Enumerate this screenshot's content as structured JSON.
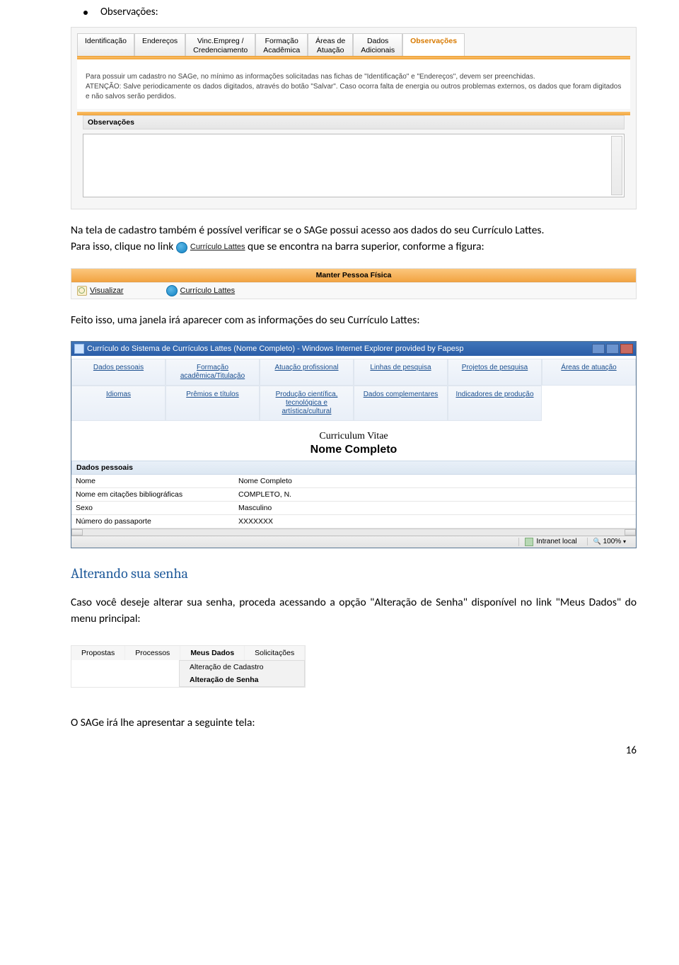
{
  "bullet": {
    "label": "Observações:"
  },
  "tabs": {
    "items": [
      "Identificação",
      "Endereços",
      "Vinc.Empreg /\nCredenciamento",
      "Formação\nAcadêmica",
      "Áreas de\nAtuação",
      "Dados\nAdicionais",
      "Observações"
    ],
    "selected_index": 6
  },
  "info_text": "Para possuir um cadastro no SAGe, no mínimo as informações solicitadas nas fichas de \"Identificação\" e \"Endereços\", devem ser preenchidas.\nATENÇÃO: Salve periodicamente os dados digitados, através do botão \"Salvar\". Caso ocorra falta de energia ou outros problemas externos, os dados que foram digitados e não salvos serão perdidos.",
  "obs_section_label": "Observações",
  "para1_a": "Na tela de cadastro também é possível verificar se o SAGe possui acesso aos dados do seu Currículo Lattes.",
  "para1_b_pre": "Para isso, clique no link ",
  "para1_b_link": "Currículo Lattes",
  "para1_b_post": " que se encontra na barra superior, conforme a figura:",
  "manter": {
    "title": "Manter Pessoa Física",
    "visualizar": "Visualizar",
    "lattes": "Currículo Lattes"
  },
  "para2": "Feito isso, uma janela irá aparecer com as informações do seu Currículo Lattes:",
  "ie": {
    "title": "Currículo do Sistema de Currículos Lattes (Nome Completo) - Windows Internet Explorer provided by Fapesp",
    "nav_row1": [
      "Dados pessoais",
      "Formação\nacadêmica/Titulação",
      "Atuação profissional",
      "Linhas de pesquisa",
      "Projetos de pesquisa",
      "Áreas de atuação"
    ],
    "nav_row2": [
      "Idiomas",
      "Prêmios e títulos",
      "Produção científica,\ntecnológica e artística/cultural",
      "Dados complementares",
      "Indicadores de produção",
      ""
    ],
    "cv_label": "Curriculum Vitae",
    "name": "Nome Completo",
    "section": "Dados pessoais",
    "rows": [
      {
        "k": "Nome",
        "v": "Nome Completo"
      },
      {
        "k": "Nome em citações bibliográficas",
        "v": "COMPLETO, N."
      },
      {
        "k": "Sexo",
        "v": "Masculino"
      },
      {
        "k": "Número do passaporte",
        "v": "XXXXXXX"
      }
    ],
    "zone": "Intranet local",
    "zoom": "100%"
  },
  "heading_alt": "Alterando sua senha",
  "para3": "Caso você deseje alterar sua senha, proceda acessando a opção \"Alteração de Senha\" disponível no link \"Meus Dados\" do menu principal:",
  "menu": {
    "top": [
      "Propostas",
      "Processos",
      "Meus Dados",
      "Solicitações"
    ],
    "sel_index": 2,
    "sub": [
      "Alteração de Cadastro",
      "Alteração de Senha"
    ],
    "sub_bold_index": 1
  },
  "para4": "O SAGe irá lhe apresentar a seguinte tela:",
  "page_number": "16"
}
